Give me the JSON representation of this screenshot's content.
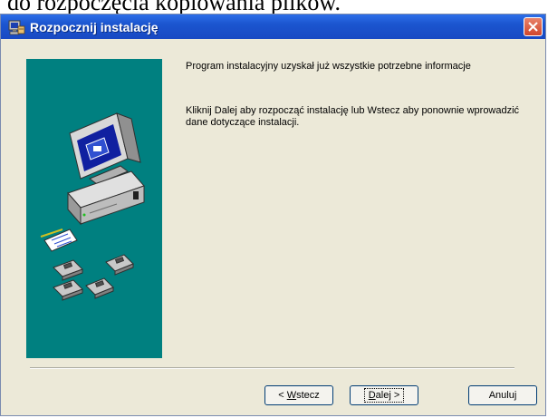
{
  "background_text": "do rozpoczęcia kopiowania plików.",
  "window": {
    "title": "Rozpocznij instalację",
    "title_icon": "installer-icon",
    "close_icon": "close-icon"
  },
  "content": {
    "message1": "Program instalacyjny uzyskał już wszystkie potrzebne informacje",
    "message2": "Kliknij Dalej aby rozpocząć instalację lub Wstecz aby ponownie wprowadzić dane dotyczące instalacji."
  },
  "buttons": {
    "back_prefix": "< ",
    "back_mnemonic": "W",
    "back_rest": "stecz",
    "next_mnemonic": "D",
    "next_rest": "alej >",
    "cancel": "Anuluj"
  },
  "colors": {
    "titlebar": "#1b55cf",
    "side_panel": "#008080",
    "dialog_bg": "#ece9d8",
    "close_button": "#d0462c"
  }
}
